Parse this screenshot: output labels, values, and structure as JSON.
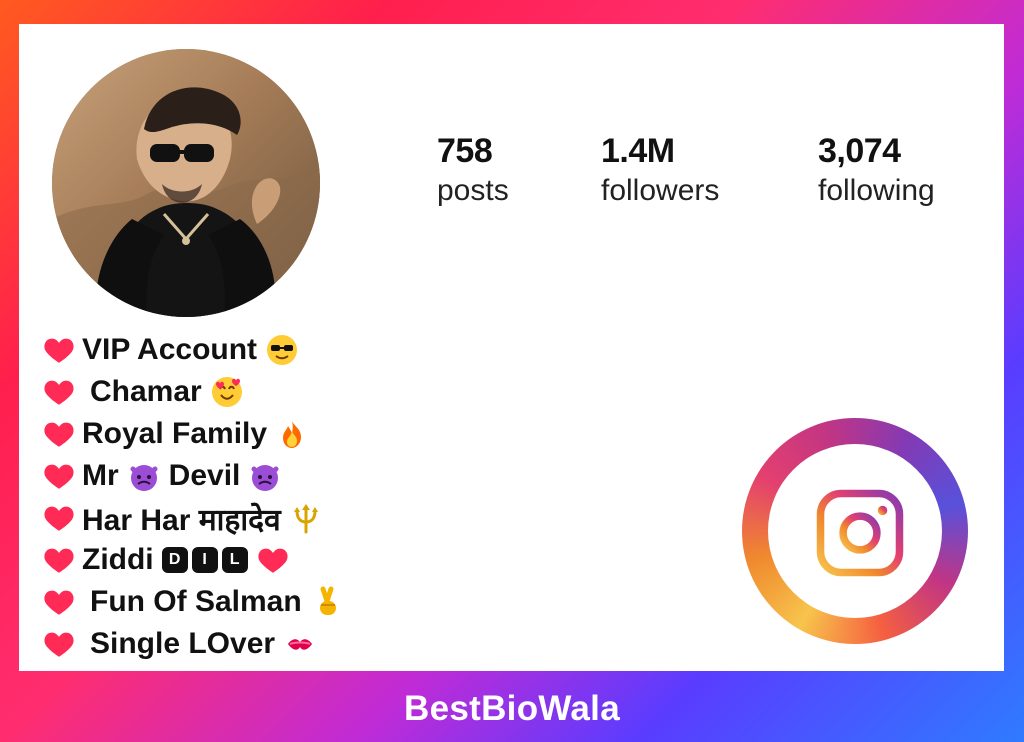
{
  "profile": {
    "stats": [
      {
        "num": "758",
        "label": "posts"
      },
      {
        "num": "1.4M",
        "label": "followers"
      },
      {
        "num": "3,074",
        "label": "following"
      }
    ],
    "bio_lines": [
      {
        "text": "VIP Account",
        "emoji": "sunglasses-emoji"
      },
      {
        "text": "Chamar",
        "emoji": "smiling-face-hearts-emoji"
      },
      {
        "text": "Royal Family",
        "emoji": "fire-emoji"
      },
      {
        "text": "Mr",
        "emoji": "devil-emoji",
        "text2": "Devil",
        "emoji2": "devil-emoji"
      },
      {
        "text": "Har Har माहादेव",
        "emoji": "trident-emoji"
      },
      {
        "text": "Ziddi",
        "badges": [
          "D",
          "I",
          "L"
        ],
        "emoji": "heart-emoji"
      },
      {
        "text": "Fun Of Salman",
        "emoji": "victory-hand-emoji"
      },
      {
        "text": "Single LOver",
        "emoji": "kiss-mark-emoji"
      }
    ]
  },
  "brand": {
    "label": "BestBioWala"
  },
  "colors": {
    "heart": "#ff2a55",
    "instagram_gradient": [
      "#f7c44c",
      "#f0882e",
      "#e4406f",
      "#c13584",
      "#833ab4",
      "#5851db"
    ]
  }
}
